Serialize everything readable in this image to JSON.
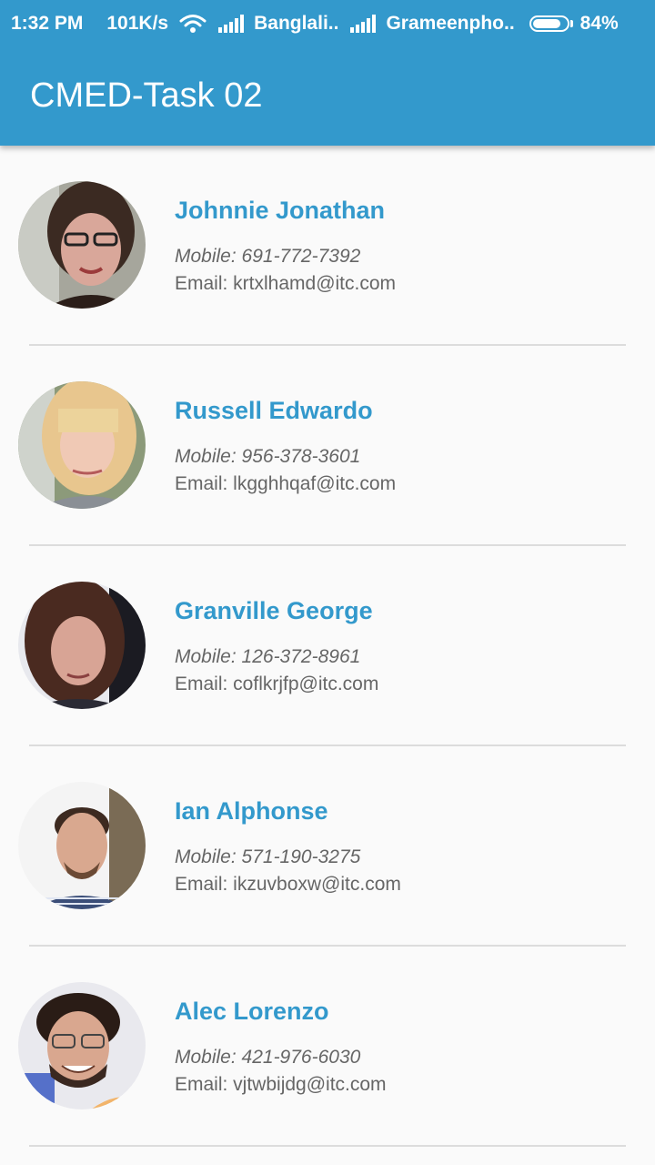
{
  "status_bar": {
    "time": "1:32 PM",
    "speed": "101K/s",
    "carrier1": "Banglali..",
    "carrier2": "Grameenpho..",
    "battery": "84%",
    "battery_level": 0.84
  },
  "app_bar": {
    "title": "CMED-Task 02"
  },
  "contacts": [
    {
      "name": "Johnnie Jonathan",
      "mobile": "Mobile: 691-772-7392",
      "email": "Email: krtxlhamd@itc.com"
    },
    {
      "name": "Russell Edwardo",
      "mobile": "Mobile: 956-378-3601",
      "email": "Email: lkgghhqaf@itc.com"
    },
    {
      "name": "Granville George",
      "mobile": "Mobile: 126-372-8961",
      "email": "Email: coflkrjfp@itc.com"
    },
    {
      "name": "Ian Alphonse",
      "mobile": "Mobile: 571-190-3275",
      "email": "Email: ikzuvboxw@itc.com"
    },
    {
      "name": "Alec Lorenzo",
      "mobile": "Mobile: 421-976-6030",
      "email": "Email: vjtwbijdg@itc.com"
    }
  ],
  "colors": {
    "primary": "#3399cc",
    "background": "#fafafa",
    "secondary_text": "#666666",
    "divider": "#dcdcdc"
  },
  "icons": [
    "wifi-icon",
    "signal-icon",
    "battery-icon"
  ]
}
